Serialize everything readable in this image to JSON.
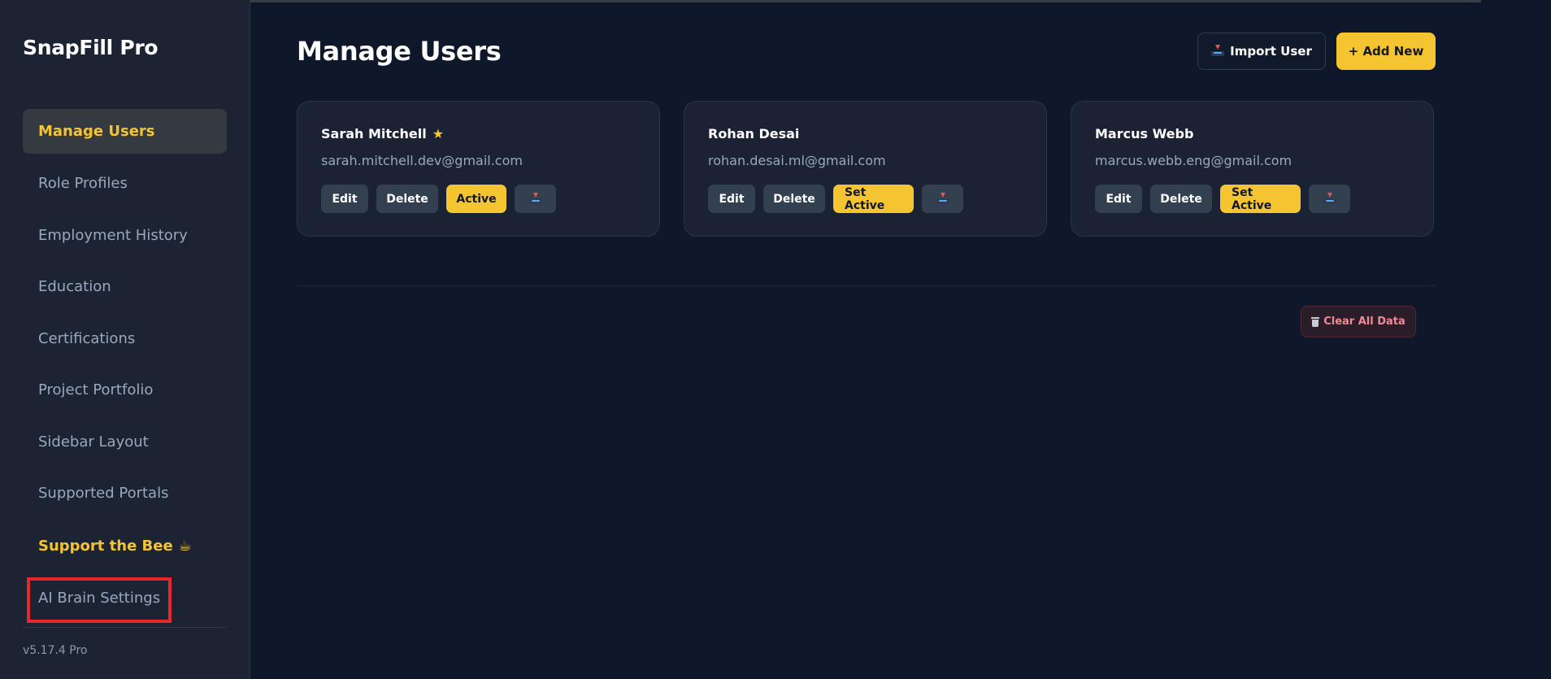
{
  "app": {
    "brand": "SnapFill Pro",
    "version": "v5.17.4 Pro"
  },
  "sidebar": {
    "items": [
      {
        "label": "Manage Users",
        "active": true
      },
      {
        "label": "Role Profiles"
      },
      {
        "label": "Employment History"
      },
      {
        "label": "Education"
      },
      {
        "label": "Certifications"
      },
      {
        "label": "Project Portfolio"
      },
      {
        "label": "Sidebar Layout"
      },
      {
        "label": "Supported Portals"
      },
      {
        "label": "Support the Bee",
        "emoji": "☕"
      },
      {
        "label": "AI Brain Settings",
        "highlighted": true
      }
    ]
  },
  "header": {
    "title": "Manage Users",
    "import_label": "Import User",
    "add_label": "+ Add New"
  },
  "users": [
    {
      "name": "Sarah Mitchell",
      "starred": true,
      "email": "sarah.mitchell.dev@gmail.com",
      "edit": "Edit",
      "delete": "Delete",
      "status": "Active"
    },
    {
      "name": "Rohan Desai",
      "starred": false,
      "email": "rohan.desai.ml@gmail.com",
      "edit": "Edit",
      "delete": "Delete",
      "status": "Set Active"
    },
    {
      "name": "Marcus Webb",
      "starred": false,
      "email": "marcus.webb.eng@gmail.com",
      "edit": "Edit",
      "delete": "Delete",
      "status": "Set Active"
    }
  ],
  "footer": {
    "clear_label": "Clear All Data"
  },
  "icons": {
    "star": "star-icon",
    "export": "export-tray-icon",
    "import": "import-tray-icon",
    "trash": "trash-icon"
  },
  "colors": {
    "accent": "#f5c431",
    "background": "#0f172a",
    "sidebar": "#1c2434",
    "card": "#1a2234",
    "danger": "#f08a96",
    "highlight_border": "#e8272b"
  }
}
